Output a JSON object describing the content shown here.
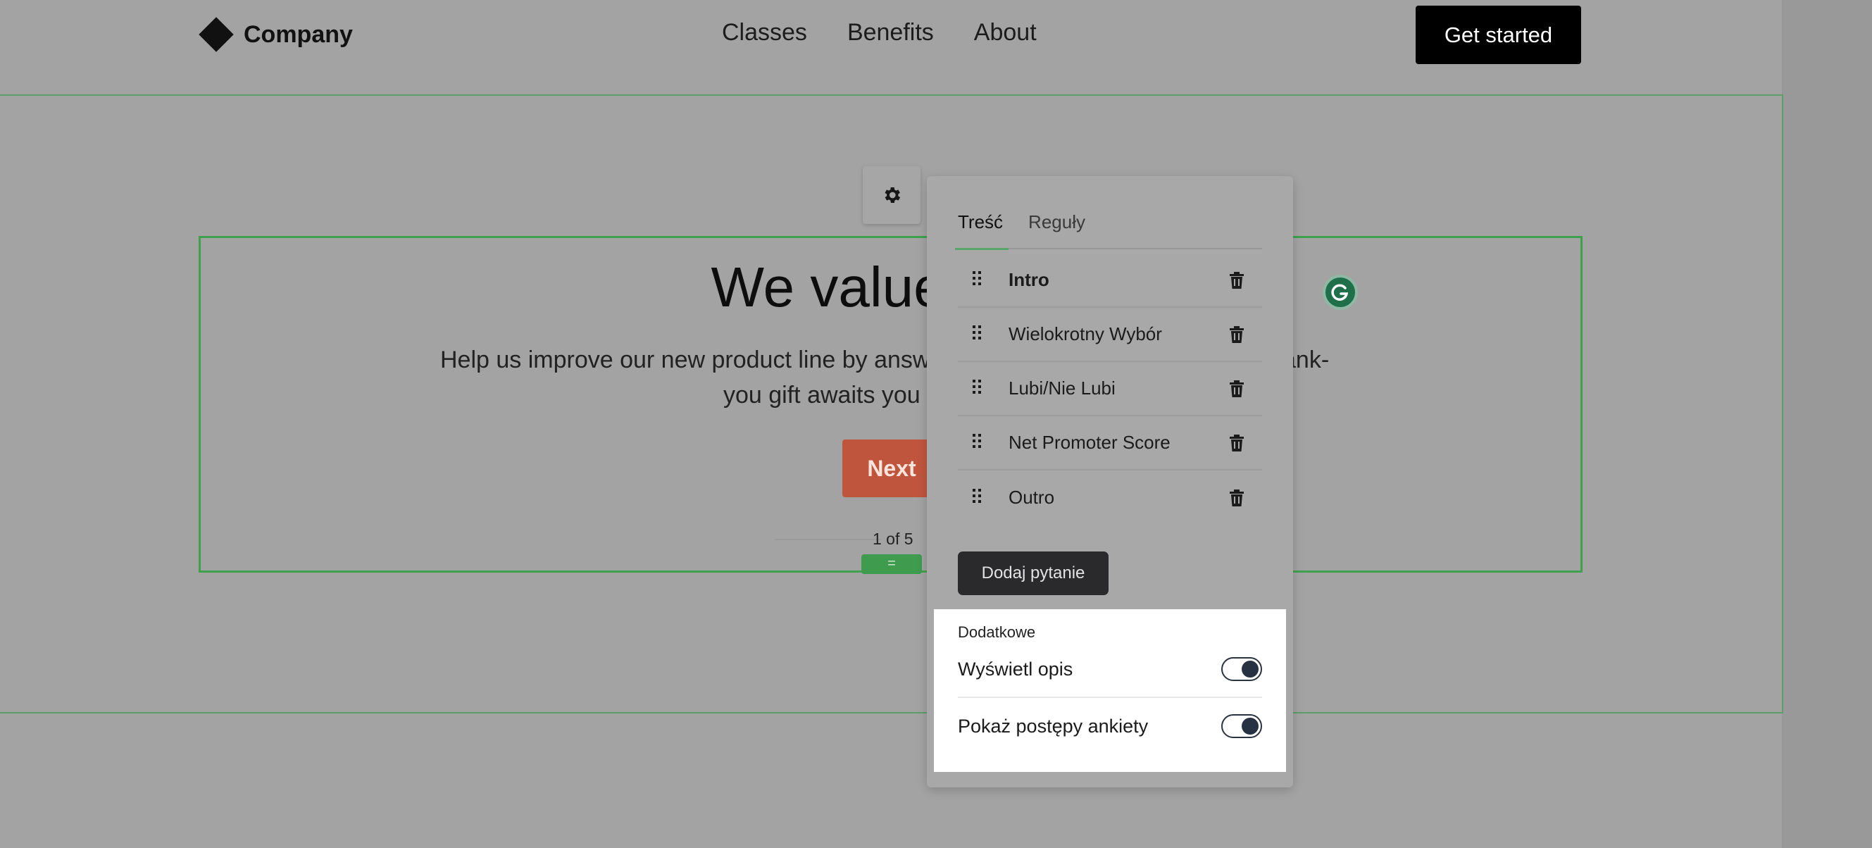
{
  "header": {
    "brand": "Company",
    "nav": [
      "Classes",
      "Benefits",
      "About"
    ],
    "cta": "Get started"
  },
  "hero": {
    "title": "We value your",
    "subtitle_line1": "Help us improve our new product line by answ",
    "subtitle_line1_tail": "ank-",
    "subtitle_line2": "you gift awaits you",
    "next_label": "Next",
    "progress": "1 of 5",
    "drag_glyph": "="
  },
  "panel": {
    "tabs": [
      "Treść",
      "Reguły"
    ],
    "questions": [
      "Intro",
      "Wielokrotny Wybór",
      "Lubi/Nie Lubi",
      "Net Promoter Score",
      "Outro"
    ],
    "add_label": "Dodaj pytanie",
    "extra": {
      "title": "Dodatkowe",
      "options": [
        {
          "label": "Wyświetl opis",
          "on": true
        },
        {
          "label": "Pokaż postępy ankiety",
          "on": true
        }
      ]
    }
  },
  "colors": {
    "accent_green": "#3fa14e",
    "next_button": "#c0553d",
    "grammarly": "#1f6f4a"
  },
  "icons": {
    "gear": "gear-icon",
    "drag": "drag-grip-icon",
    "trash": "trash-icon",
    "grammarly": "grammarly-icon"
  }
}
